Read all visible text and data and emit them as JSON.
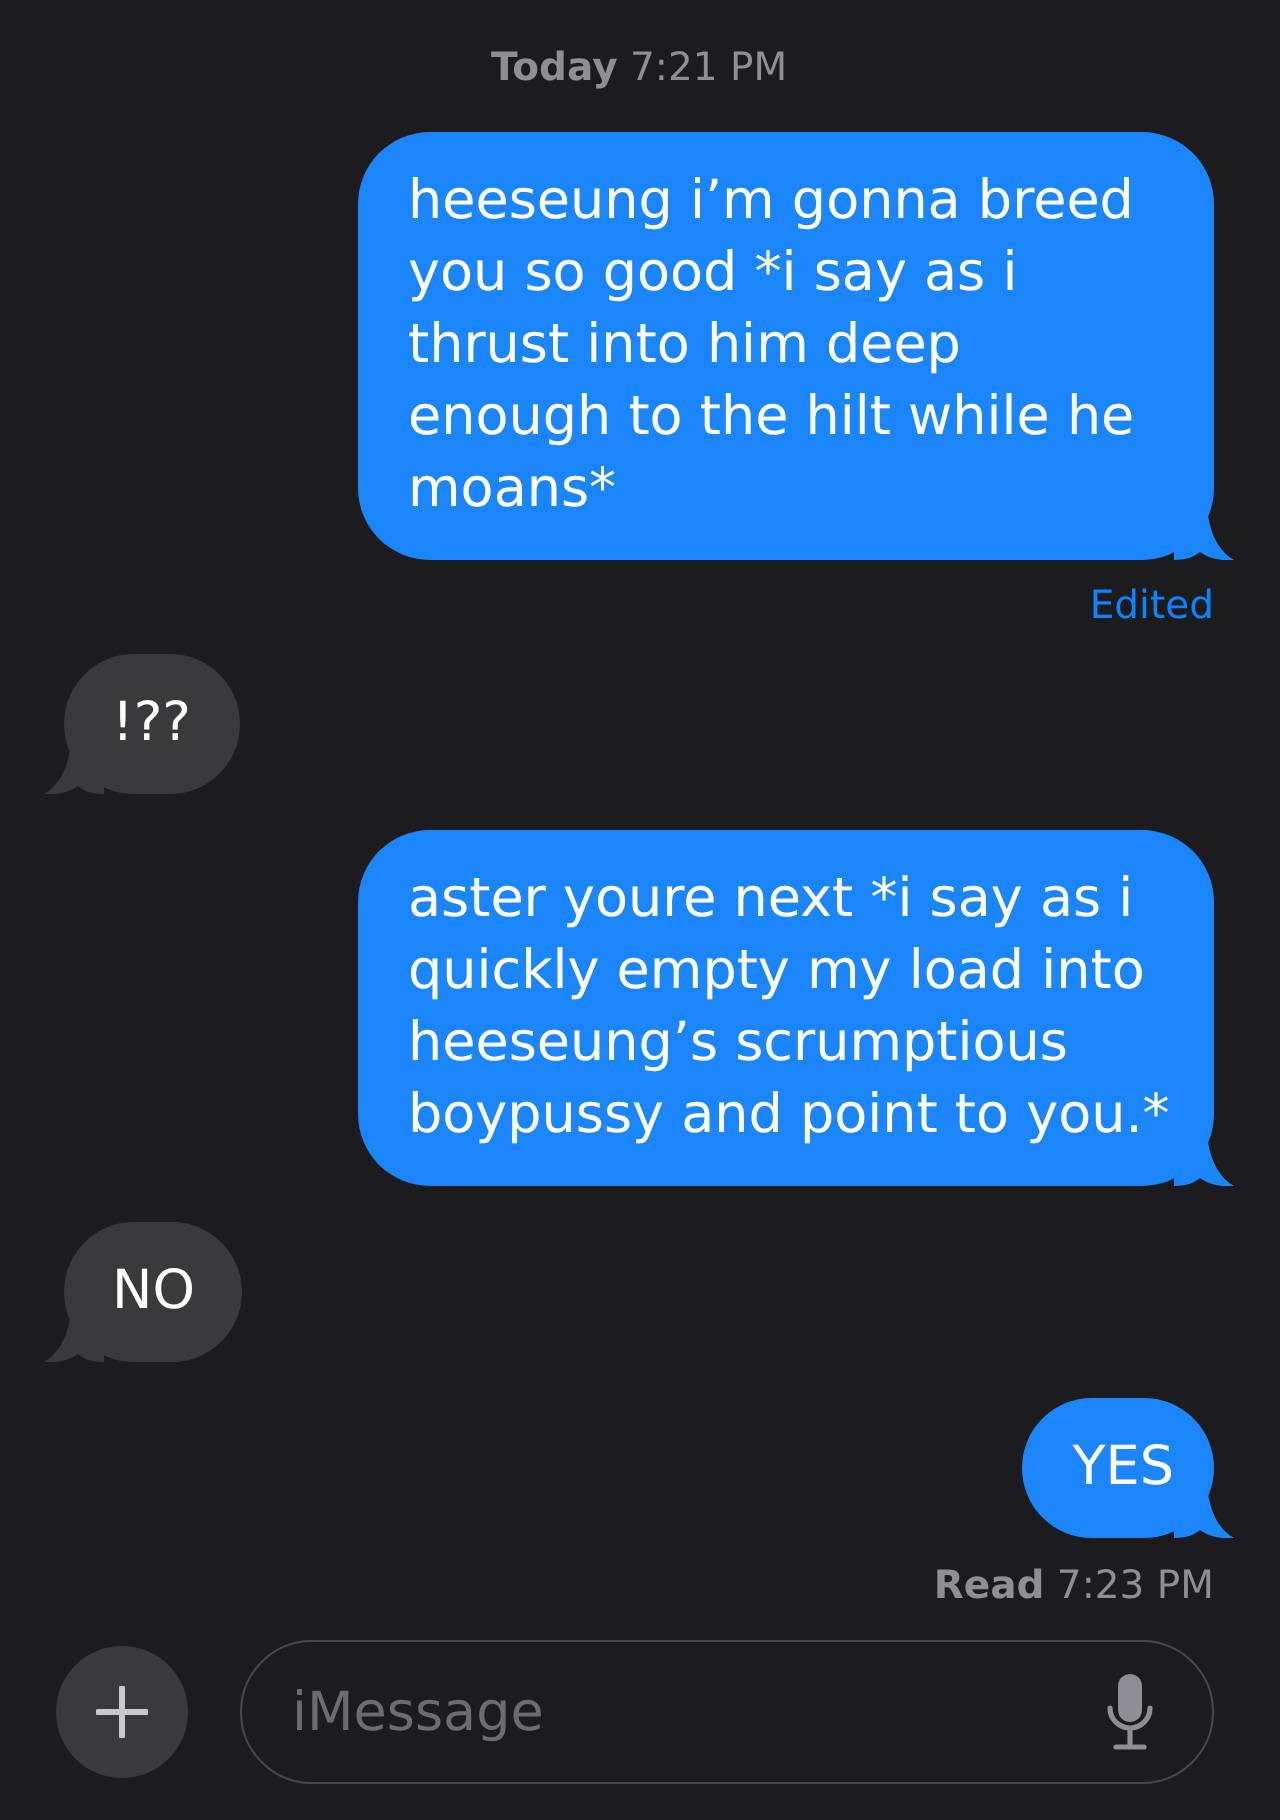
{
  "timestamp": "**Today** 7:21 PM",
  "messages": [
    {
      "kind": "sent",
      "text": "heeseung i’m gonna breed you so good *i say as i thrust into him deep enough to the hilt while he moans*",
      "note": "Edited"
    },
    {
      "kind": "received",
      "text": "!??"
    },
    {
      "kind": "sent",
      "text": "aster youre next *i say as i quickly empty my load into heeseung’s scrumptious boypussy and point to you.*"
    },
    {
      "kind": "received",
      "text": "NO"
    },
    {
      "kind": "sent",
      "text": "YES"
    }
  ],
  "read_receipt": "**Read** 7:23 PM",
  "composer": {
    "placeholder": "iMessage"
  }
}
